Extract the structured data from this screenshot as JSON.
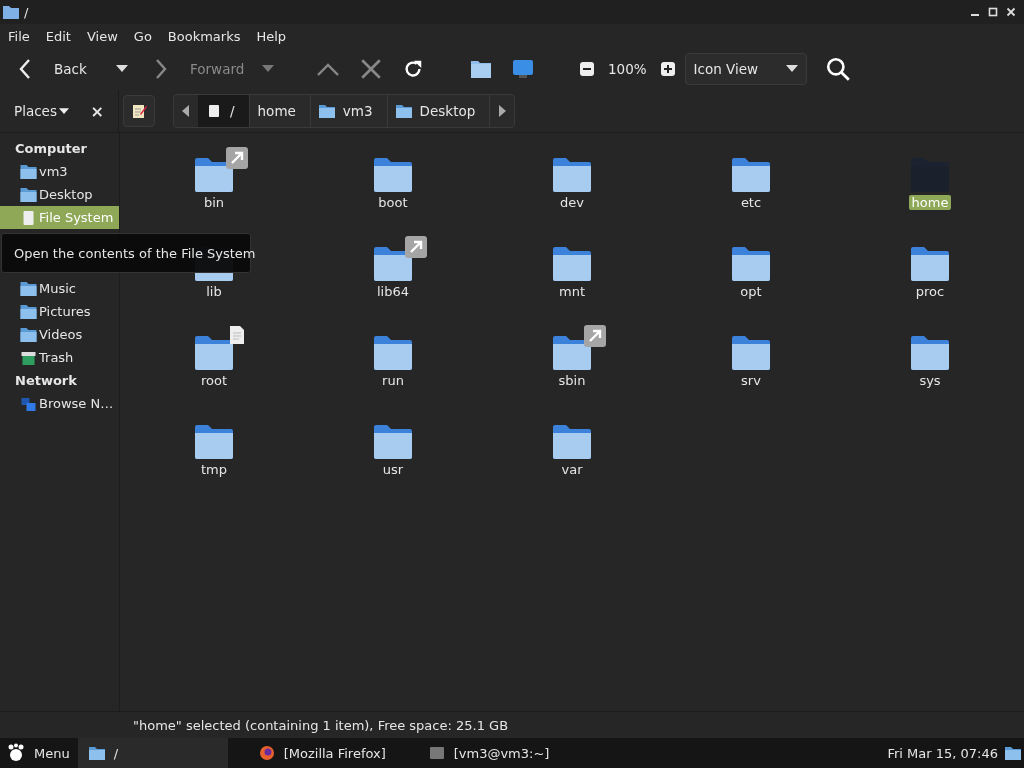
{
  "window": {
    "title": "/"
  },
  "menu": [
    "File",
    "Edit",
    "View",
    "Go",
    "Bookmarks",
    "Help"
  ],
  "toolbar": {
    "back": "Back",
    "forward": "Forward",
    "zoom": "100%",
    "view_mode": "Icon View"
  },
  "places": {
    "label": "Places",
    "close": "×"
  },
  "breadcrumb": [
    {
      "label": "/",
      "kind": "drive",
      "selected": true
    },
    {
      "label": "home",
      "kind": "plain",
      "selected": false
    },
    {
      "label": "vm3",
      "kind": "home",
      "selected": false
    },
    {
      "label": "Desktop",
      "kind": "desktop",
      "selected": false
    }
  ],
  "sidebar": {
    "sections": [
      {
        "title": "Computer",
        "items": [
          {
            "label": "vm3",
            "kind": "home",
            "selected": false
          },
          {
            "label": "Desktop",
            "kind": "desktop",
            "selected": false
          },
          {
            "label": "File System",
            "kind": "drive",
            "selected": true
          },
          {
            "label": "Music",
            "kind": "music",
            "selected": false
          },
          {
            "label": "Pictures",
            "kind": "pictures",
            "selected": false
          },
          {
            "label": "Videos",
            "kind": "videos",
            "selected": false
          },
          {
            "label": "Trash",
            "kind": "trash",
            "selected": false
          }
        ]
      },
      {
        "title": "Network",
        "items": [
          {
            "label": "Browse N…",
            "kind": "network",
            "selected": false
          }
        ]
      }
    ],
    "tooltip": "Open the contents of the File System"
  },
  "files": [
    {
      "name": "bin",
      "kind": "link",
      "selected": false
    },
    {
      "name": "boot",
      "selected": false
    },
    {
      "name": "dev",
      "selected": false
    },
    {
      "name": "etc",
      "selected": false
    },
    {
      "name": "home",
      "selected": true
    },
    {
      "name": "lib",
      "selected": false
    },
    {
      "name": "lib64",
      "kind": "link",
      "selected": false
    },
    {
      "name": "mnt",
      "selected": false
    },
    {
      "name": "opt",
      "selected": false
    },
    {
      "name": "proc",
      "selected": false
    },
    {
      "name": "root",
      "kind": "document",
      "selected": false
    },
    {
      "name": "run",
      "selected": false
    },
    {
      "name": "sbin",
      "kind": "link",
      "selected": false
    },
    {
      "name": "srv",
      "selected": false
    },
    {
      "name": "sys",
      "selected": false
    },
    {
      "name": "tmp",
      "selected": false
    },
    {
      "name": "usr",
      "selected": false
    },
    {
      "name": "var",
      "selected": false
    }
  ],
  "status_bar": "\"home\" selected (containing 1 item), Free space: 25.1 GB",
  "taskbar": {
    "menu": "Menu",
    "windows": [
      {
        "label": "/",
        "kind": "folder",
        "selected": true
      },
      {
        "label": "[Mozilla Firefox]",
        "kind": "browser",
        "selected": false
      },
      {
        "label": "[vm3@vm3:~]",
        "kind": "terminal",
        "selected": false
      }
    ],
    "clock": "Fri Mar 15, 07:46"
  }
}
